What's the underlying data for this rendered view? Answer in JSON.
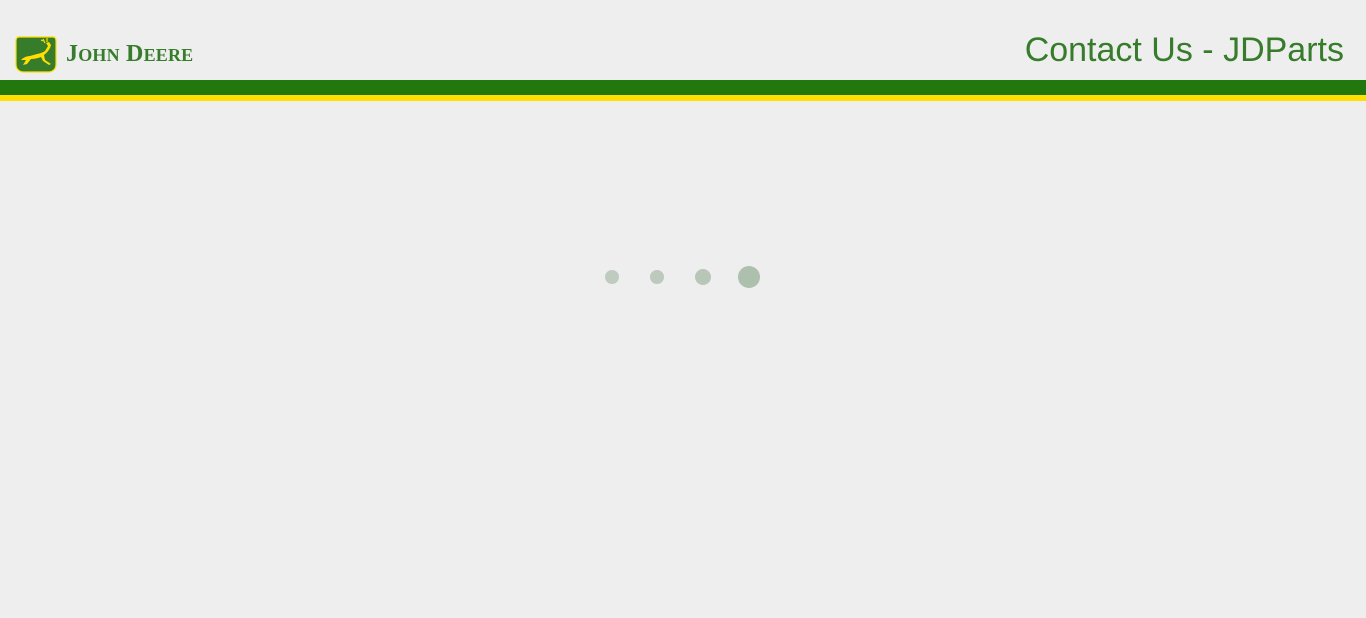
{
  "brand": {
    "name_part1_cap": "J",
    "name_part1_rest": "OHN",
    "name_part2_cap": "D",
    "name_part2_rest": "EERE",
    "logo_icon": "leaping-deer-icon",
    "colors": {
      "green": "#367c2b",
      "stripe_green": "#23780d",
      "yellow": "#ffde00"
    }
  },
  "header": {
    "title": "Contact Us - JDParts"
  },
  "loader": {
    "icon": "loading-dots-icon",
    "dot_count": 4
  }
}
